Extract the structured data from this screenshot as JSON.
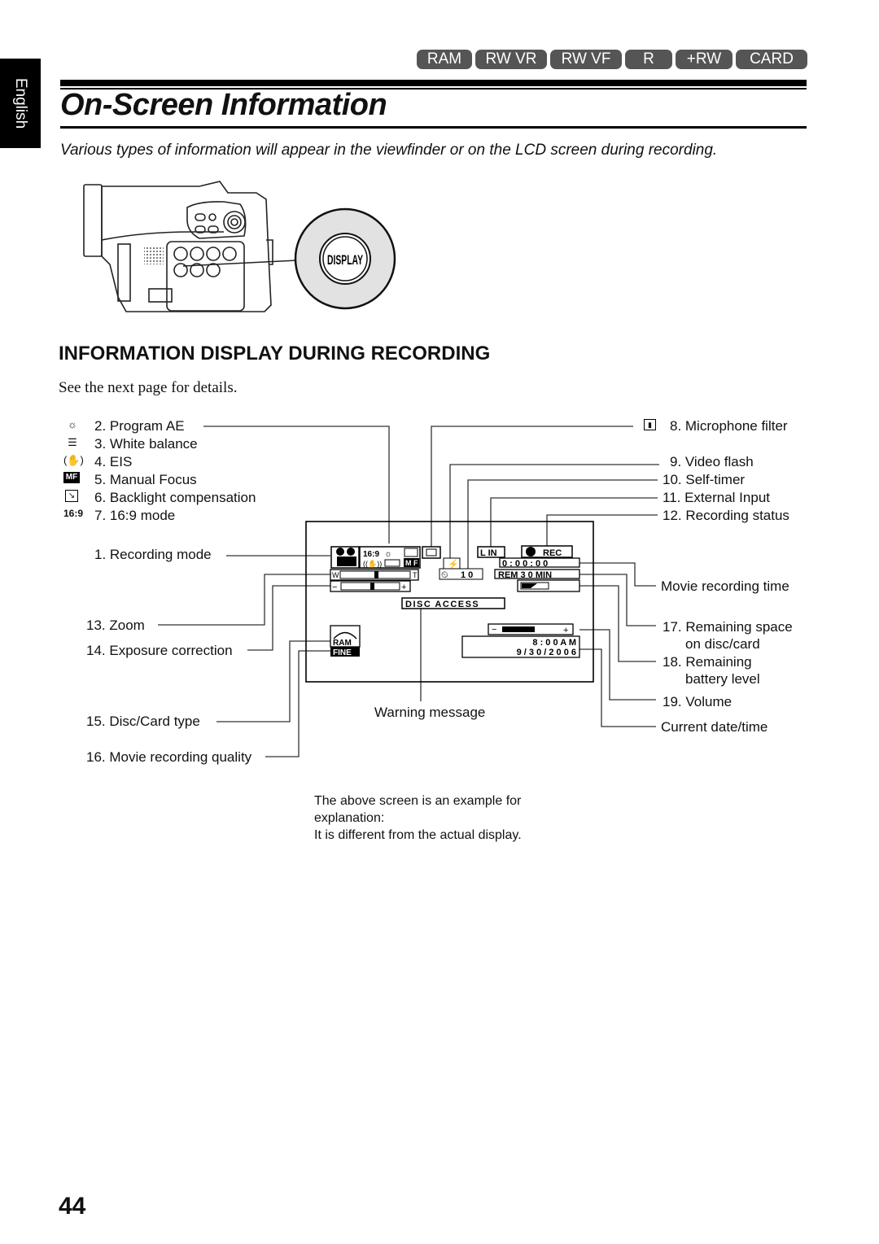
{
  "sidebar": {
    "language_tab": "English"
  },
  "media_chips": [
    "RAM",
    "RW VR",
    "RW VF",
    "R",
    "+RW",
    "CARD"
  ],
  "header": {
    "title": "On-Screen Information",
    "intro": "Various types of information will appear in the viewfinder or on the LCD screen during recording."
  },
  "illustration": {
    "button_label": "DISPLAY"
  },
  "section": {
    "heading": "INFORMATION DISPLAY DURING RECORDING",
    "subtext": "See the next page for details."
  },
  "left_icon_labels": [
    {
      "icon": "program-ae-icon",
      "label": "2. Program AE"
    },
    {
      "icon": "white-balance-icon",
      "label": "3. White balance"
    },
    {
      "icon": "eis-icon",
      "label": "4. EIS"
    },
    {
      "icon": "manual-focus-icon",
      "label": "5. Manual Focus"
    },
    {
      "icon": "backlight-icon",
      "label": "6. Backlight compensation"
    },
    {
      "icon": "wide-mode-icon",
      "label": "7. 16:9 mode"
    }
  ],
  "left_labels": {
    "recording_mode": "1. Recording mode",
    "zoom": "13. Zoom",
    "exposure": "14. Exposure correction",
    "disc_type": "15. Disc/Card type",
    "quality": "16. Movie recording quality"
  },
  "right_labels": {
    "mic_filter": "8. Microphone filter",
    "video_flash": "9. Video flash",
    "self_timer": "10. Self-timer",
    "external_input": "11. External Input",
    "recording_status": "12. Recording status",
    "movie_time": "Movie recording time",
    "remaining_space_1": "17. Remaining space",
    "remaining_space_2": "on disc/card",
    "battery_1": "18. Remaining",
    "battery_2": "battery level",
    "volume": "19. Volume",
    "date_time": "Current date/time"
  },
  "screen": {
    "wide": "16:9",
    "mf": "M F",
    "zoom_w": "W",
    "zoom_t": "T",
    "exp_minus": "−",
    "exp_plus": "+",
    "line_in": "L IN",
    "rec": "REC",
    "counter": "0 : 0 0 : 0 0",
    "remaining": "REM 3 0 MIN",
    "timer": "1 0",
    "disc_access": "DISC  ACCESS",
    "disc_type": "RAM",
    "quality": "FINE",
    "time": "8 : 0 0 A M",
    "date": "9 / 3 0 / 2 0 0 6",
    "vol_minus": "−",
    "vol_plus": "+",
    "volume_level": 0.55
  },
  "warning_label": "Warning message",
  "note": [
    "The above screen is an example for",
    "explanation:",
    "It is different from the actual display."
  ],
  "page_number": "44"
}
